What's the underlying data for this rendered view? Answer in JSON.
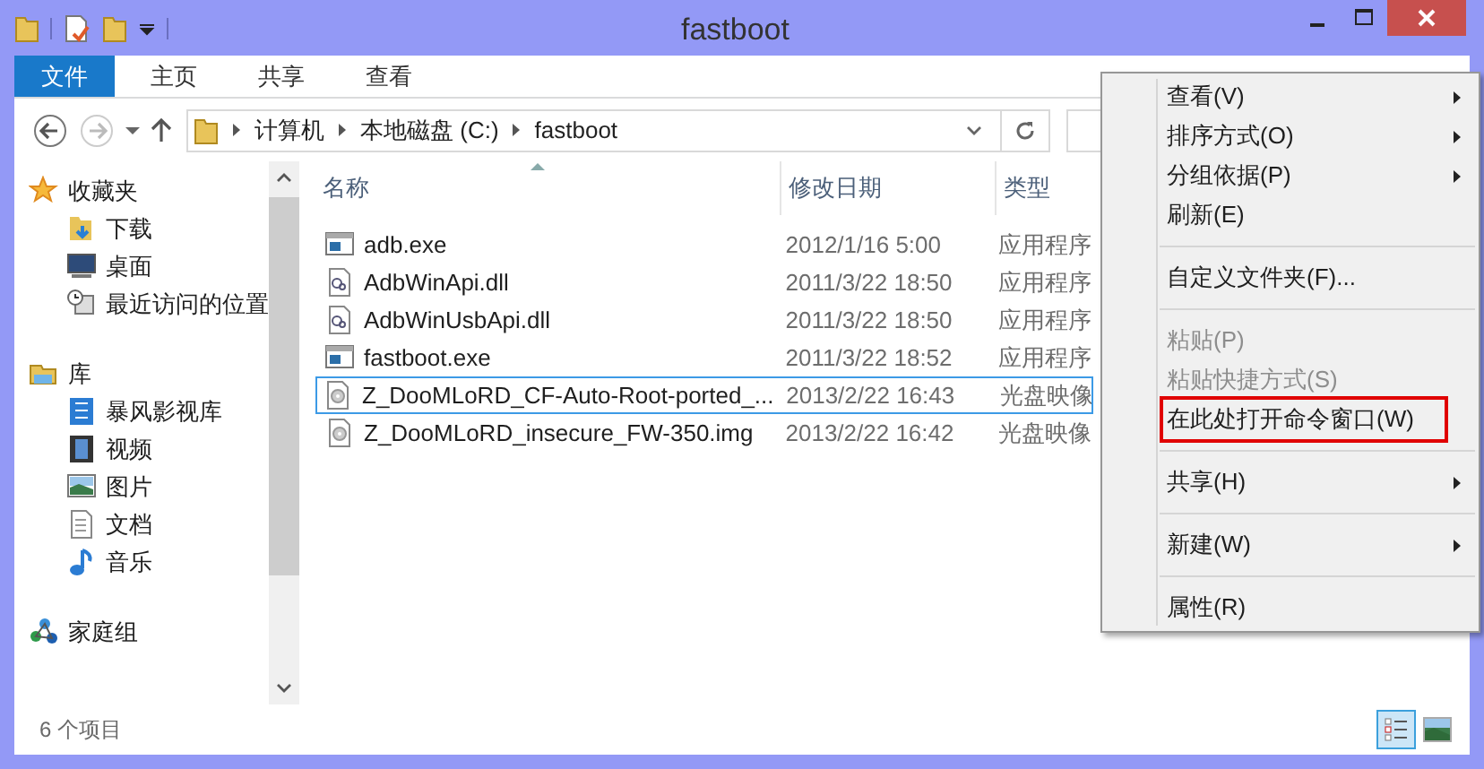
{
  "window": {
    "title": "fastboot"
  },
  "ribbon_tabs": [
    {
      "label": "文件",
      "selected": true
    },
    {
      "label": "主页",
      "selected": false
    },
    {
      "label": "共享",
      "selected": false
    },
    {
      "label": "查看",
      "selected": false
    }
  ],
  "address": {
    "breadcrumbs": [
      "计算机",
      "本地磁盘 (C:)",
      "fastboot"
    ]
  },
  "sidebar": {
    "groups": [
      {
        "label": "收藏夹",
        "children": [
          {
            "label": "下载"
          },
          {
            "label": "桌面"
          },
          {
            "label": "最近访问的位置"
          }
        ]
      },
      {
        "label": "库",
        "children": [
          {
            "label": "暴风影视库"
          },
          {
            "label": "视频"
          },
          {
            "label": "图片"
          },
          {
            "label": "文档"
          },
          {
            "label": "音乐"
          }
        ]
      },
      {
        "label": "家庭组"
      }
    ]
  },
  "table": {
    "columns": [
      "名称",
      "修改日期",
      "类型"
    ],
    "rows": [
      {
        "name": "adb.exe",
        "kind": "exe",
        "modified": "2012/1/16 5:00",
        "type": "应用程序",
        "selected": false
      },
      {
        "name": "AdbWinApi.dll",
        "kind": "dll",
        "modified": "2011/3/22 18:50",
        "type": "应用程序",
        "selected": false
      },
      {
        "name": "AdbWinUsbApi.dll",
        "kind": "dll",
        "modified": "2011/3/22 18:50",
        "type": "应用程序",
        "selected": false
      },
      {
        "name": "fastboot.exe",
        "kind": "exe",
        "modified": "2011/3/22 18:52",
        "type": "应用程序",
        "selected": false
      },
      {
        "name": "Z_DooMLoRD_CF-Auto-Root-ported_...",
        "kind": "img",
        "modified": "2013/2/22 16:43",
        "type": "光盘映像",
        "selected": true
      },
      {
        "name": "Z_DooMLoRD_insecure_FW-350.img",
        "kind": "img",
        "modified": "2013/2/22 16:42",
        "type": "光盘映像",
        "selected": false
      }
    ]
  },
  "status_bar": {
    "item_count": "6 个项目"
  },
  "context_menu": {
    "groups": [
      [
        {
          "label": "查看(V)",
          "submenu": true,
          "disabled": false,
          "highlighted": false
        },
        {
          "label": "排序方式(O)",
          "submenu": true,
          "disabled": false,
          "highlighted": false
        },
        {
          "label": "分组依据(P)",
          "submenu": true,
          "disabled": false,
          "highlighted": false
        },
        {
          "label": "刷新(E)",
          "submenu": false,
          "disabled": false,
          "highlighted": false
        }
      ],
      [
        {
          "label": "自定义文件夹(F)...",
          "submenu": false,
          "disabled": false,
          "highlighted": false
        }
      ],
      [
        {
          "label": "粘贴(P)",
          "submenu": false,
          "disabled": true,
          "highlighted": false
        },
        {
          "label": "粘贴快捷方式(S)",
          "submenu": false,
          "disabled": true,
          "highlighted": false
        },
        {
          "label": "在此处打开命令窗口(W)",
          "submenu": false,
          "disabled": false,
          "highlighted": true
        }
      ],
      [
        {
          "label": "共享(H)",
          "submenu": true,
          "disabled": false,
          "highlighted": false
        }
      ],
      [
        {
          "label": "新建(W)",
          "submenu": true,
          "disabled": false,
          "highlighted": false
        }
      ],
      [
        {
          "label": "属性(R)",
          "submenu": false,
          "disabled": false,
          "highlighted": false
        }
      ]
    ]
  }
}
